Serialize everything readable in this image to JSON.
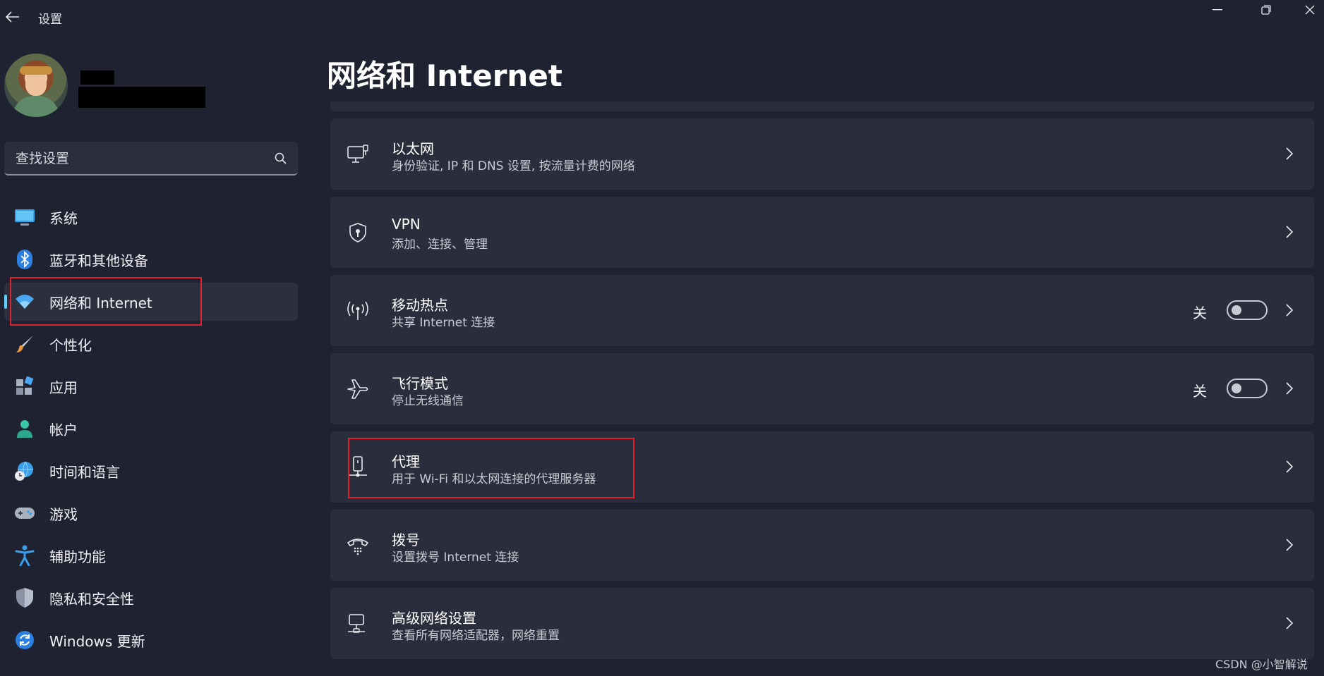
{
  "window": {
    "title": "设置"
  },
  "search": {
    "placeholder": "查找设置"
  },
  "sidebar": {
    "items": [
      {
        "label": "系统",
        "icon": "monitor-icon"
      },
      {
        "label": "蓝牙和其他设备",
        "icon": "bluetooth-icon"
      },
      {
        "label": "网络和 Internet",
        "icon": "wifi-icon",
        "active": true
      },
      {
        "label": "个性化",
        "icon": "brush-icon"
      },
      {
        "label": "应用",
        "icon": "apps-icon"
      },
      {
        "label": "帐户",
        "icon": "account-icon"
      },
      {
        "label": "时间和语言",
        "icon": "globe-clock-icon"
      },
      {
        "label": "游戏",
        "icon": "gamepad-icon"
      },
      {
        "label": "辅助功能",
        "icon": "accessibility-icon"
      },
      {
        "label": "隐私和安全性",
        "icon": "shield-icon"
      },
      {
        "label": "Windows 更新",
        "icon": "update-icon"
      }
    ]
  },
  "main": {
    "title": "网络和 Internet",
    "cards": [
      {
        "title": "以太网",
        "desc": "身份验证, IP 和 DNS 设置, 按流量计费的网络",
        "icon": "ethernet-icon"
      },
      {
        "title": "VPN",
        "desc": "添加、连接、管理",
        "icon": "vpn-shield-icon"
      },
      {
        "title": "移动热点",
        "desc": "共享 Internet 连接",
        "icon": "hotspot-icon",
        "toggle_label": "关",
        "toggle_on": false
      },
      {
        "title": "飞行模式",
        "desc": "停止无线通信",
        "icon": "airplane-icon",
        "toggle_label": "关",
        "toggle_on": false
      },
      {
        "title": "代理",
        "desc": "用于 Wi-Fi 和以太网连接的代理服务器",
        "icon": "proxy-icon"
      },
      {
        "title": "拨号",
        "desc": "设置拨号 Internet 连接",
        "icon": "dialup-icon"
      },
      {
        "title": "高级网络设置",
        "desc": "查看所有网络适配器，网络重置",
        "icon": "advanced-network-icon"
      }
    ]
  },
  "watermark": "CSDN @小智解说",
  "colors": {
    "accent": "#60cdff",
    "highlight": "#e0202a",
    "background": "#1f2230",
    "card": "#2a2d3b"
  }
}
